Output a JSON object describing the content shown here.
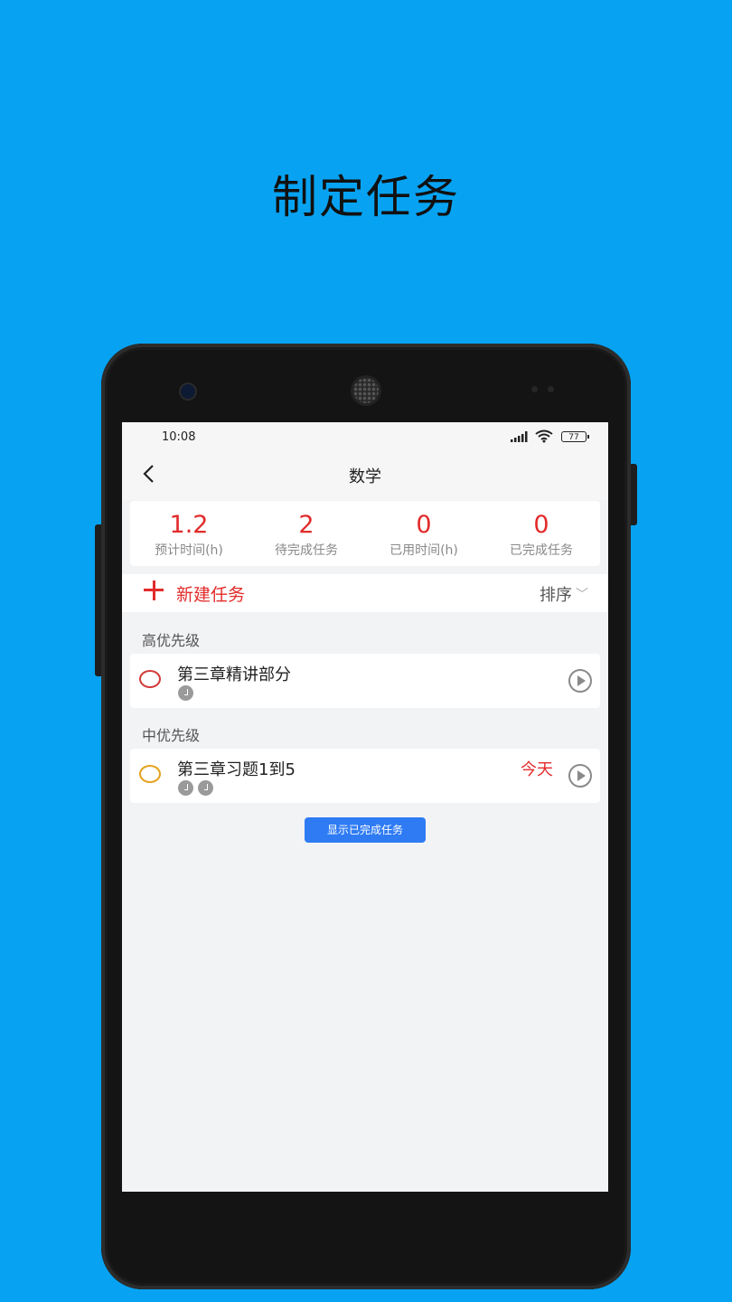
{
  "headline": "制定任务",
  "status_bar": {
    "time": "10:08",
    "battery": "77"
  },
  "header": {
    "title": "数学"
  },
  "stats": [
    {
      "value": "1.2",
      "label": "预计时间(h)"
    },
    {
      "value": "2",
      "label": "待完成任务"
    },
    {
      "value": "0",
      "label": "已用时间(h)"
    },
    {
      "value": "0",
      "label": "已完成任务"
    }
  ],
  "toolbar": {
    "new_task_label": "新建任务",
    "sort_label": "排序"
  },
  "sections": [
    {
      "label": "高优先级",
      "tasks": [
        {
          "title": "第三章精讲部分",
          "pomodoros": 1,
          "due": "",
          "priority_color": "#d23a3a"
        }
      ]
    },
    {
      "label": "中优先级",
      "tasks": [
        {
          "title": "第三章习题1到5",
          "pomodoros": 2,
          "due": "今天",
          "priority_color": "#e4a21c"
        }
      ]
    }
  ],
  "show_completed_label": "显示已完成任务",
  "colors": {
    "background": "#07a3f2",
    "accent_red": "#e22b2b",
    "button_blue": "#2e7bf4"
  }
}
